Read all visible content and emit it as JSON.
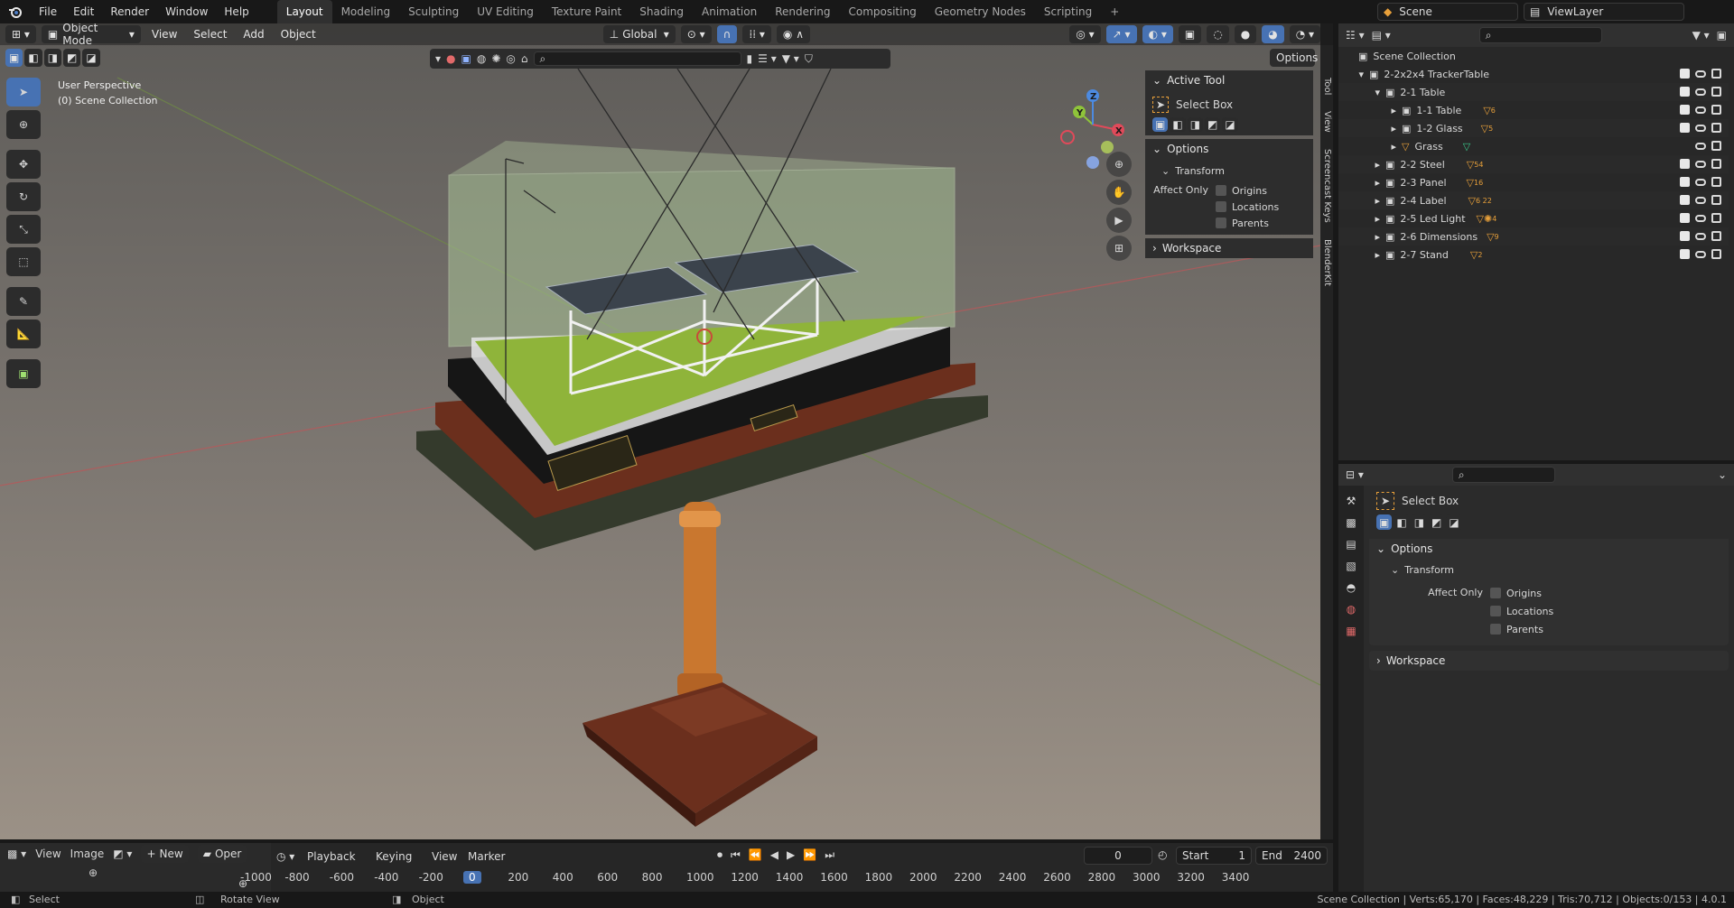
{
  "topbar": {
    "menus": [
      "File",
      "Edit",
      "Render",
      "Window",
      "Help"
    ],
    "workspaces": [
      "Layout",
      "Modeling",
      "Sculpting",
      "UV Editing",
      "Texture Paint",
      "Shading",
      "Animation",
      "Rendering",
      "Compositing",
      "Geometry Nodes",
      "Scripting"
    ],
    "active_workspace": "Layout",
    "add_tab": "+",
    "scene": "Scene",
    "view_layer": "ViewLayer"
  },
  "viewport": {
    "mode": "Object Mode",
    "menus": [
      "View",
      "Select",
      "Add",
      "Object"
    ],
    "orientation": "Global",
    "options_label": "Options",
    "perspective_label": "User Perspective",
    "collection_label": "(0) Scene Collection",
    "gizmo_axes": {
      "x": "X",
      "y": "Y",
      "z": "Z"
    },
    "side_tabs": [
      "Tool",
      "View",
      "Screencast Keys",
      "BlenderKit"
    ]
  },
  "npanel": {
    "active_tool_header": "Active Tool",
    "tool_name": "Select Box",
    "options_header": "Options",
    "transform_header": "Transform",
    "affect_only": "Affect Only",
    "checks": [
      "Origins",
      "Locations",
      "Parents"
    ],
    "workspace_header": "Workspace"
  },
  "outliner": {
    "root": "Scene Collection",
    "rows": [
      {
        "label": "2-2x2x4 TrackerTable",
        "level": 1,
        "badge": ""
      },
      {
        "label": "2-1 Table",
        "level": 2,
        "badge": ""
      },
      {
        "label": "1-1 Table",
        "level": 3,
        "badge": "6"
      },
      {
        "label": "1-2 Glass",
        "level": 3,
        "badge": "5"
      },
      {
        "label": "Grass",
        "level": 3,
        "badge": ""
      },
      {
        "label": "2-2 Steel",
        "level": 2,
        "badge": "54"
      },
      {
        "label": "2-3 Panel",
        "level": 2,
        "badge": "16"
      },
      {
        "label": "2-4 Label",
        "level": 2,
        "badge": "6 22"
      },
      {
        "label": "2-5 Led Light",
        "level": 2,
        "badge": "4"
      },
      {
        "label": "2-6 Dimensions",
        "level": 2,
        "badge": "9"
      },
      {
        "label": "2-7 Stand",
        "level": 2,
        "badge": "2"
      }
    ]
  },
  "properties": {
    "tool_name": "Select Box",
    "options_header": "Options",
    "transform_header": "Transform",
    "affect_only": "Affect Only",
    "checks": [
      "Origins",
      "Locations",
      "Parents"
    ],
    "workspace_header": "Workspace"
  },
  "bottom_left": {
    "menus": [
      "View",
      "Image"
    ],
    "new_label": "New",
    "open_label": "Oper"
  },
  "timeline": {
    "menus": [
      "Playback",
      "Keying",
      "View",
      "Marker"
    ],
    "current_frame": "0",
    "start_label": "Start",
    "start_value": "1",
    "end_label": "End",
    "end_value": "2400",
    "ruler": [
      "-1000",
      "-800",
      "-600",
      "-400",
      "-200",
      "0",
      "200",
      "400",
      "600",
      "800",
      "1000",
      "1200",
      "1400",
      "1600",
      "1800",
      "2000",
      "2200",
      "2400",
      "2600",
      "2800",
      "3000",
      "3200",
      "3400"
    ]
  },
  "status": {
    "select": "Select",
    "rotate": "Rotate View",
    "object": "Object",
    "stats": "Scene Collection | Verts:65,170 | Faces:48,229 | Tris:70,712 | Objects:0/153 | 4.0.1"
  },
  "colors": {
    "accent": "#4772b3",
    "grass": "#8fb43a",
    "wood": "#6b2f1d",
    "copper": "#c9772f"
  }
}
